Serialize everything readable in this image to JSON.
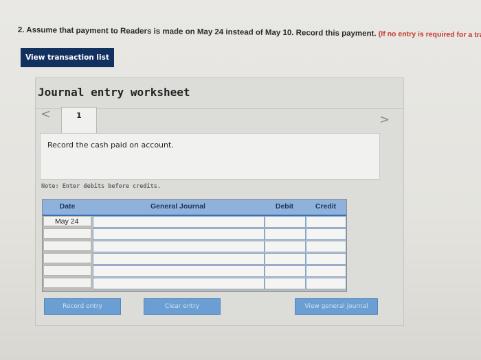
{
  "question": {
    "text": "2. Assume that payment to Readers is made on May 24 instead of May 10. Record this payment.",
    "note": "(If no entry is required for a tra"
  },
  "toolbar": {
    "view_transactions_label": "View transaction list"
  },
  "worksheet": {
    "title": "Journal entry worksheet",
    "prev_glyph": "<",
    "next_glyph": ">",
    "tab_label": "1",
    "instruction": "Record the cash paid on account.",
    "note": "Note: Enter debits before credits."
  },
  "journal": {
    "headers": {
      "date": "Date",
      "account": "General Journal",
      "debit": "Debit",
      "credit": "Credit"
    },
    "rows": [
      {
        "date": "May 24",
        "account": "",
        "debit": "",
        "credit": ""
      },
      {
        "date": "",
        "account": "",
        "debit": "",
        "credit": ""
      },
      {
        "date": "",
        "account": "",
        "debit": "",
        "credit": ""
      },
      {
        "date": "",
        "account": "",
        "debit": "",
        "credit": ""
      },
      {
        "date": "",
        "account": "",
        "debit": "",
        "credit": ""
      },
      {
        "date": "",
        "account": "",
        "debit": "",
        "credit": ""
      }
    ]
  },
  "actions": {
    "record_label": "Record entry",
    "clear_label": "Clear entry",
    "view_journal_label": "View general journal"
  }
}
